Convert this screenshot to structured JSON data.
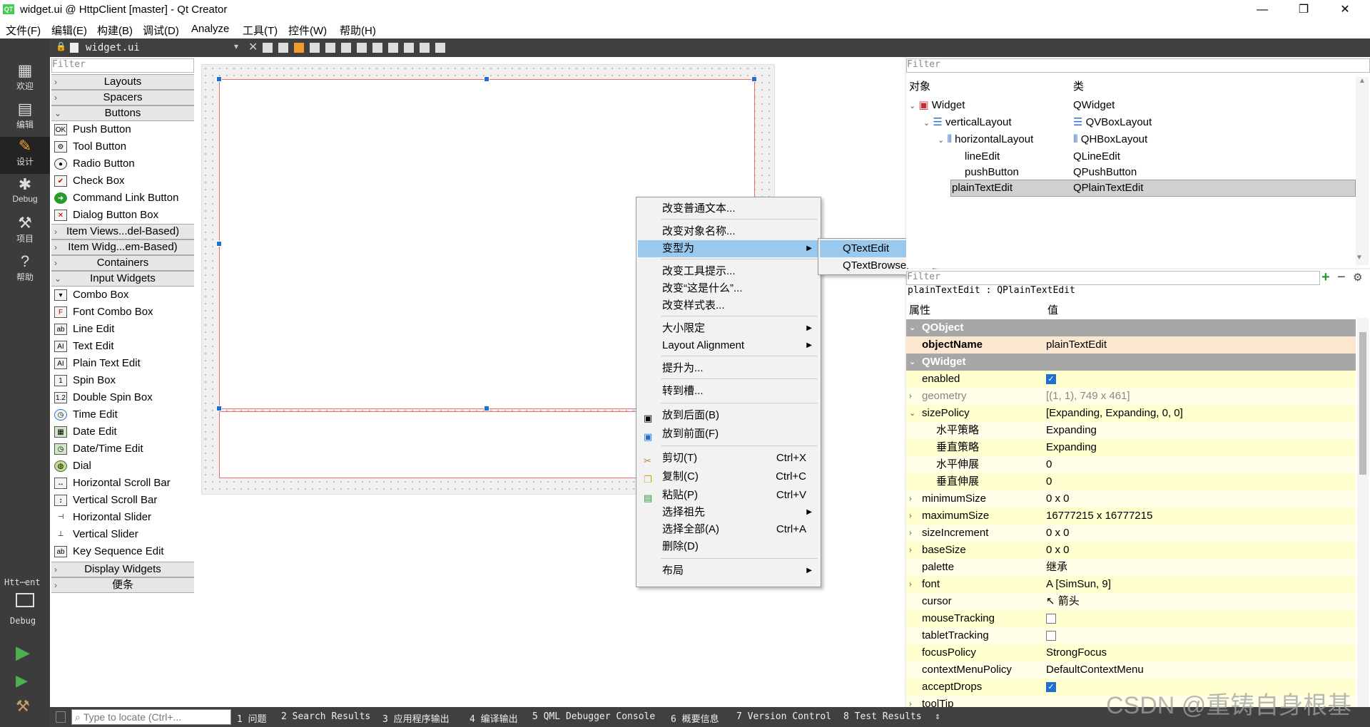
{
  "window": {
    "title": "widget.ui @ HttpClient [master] - Qt Creator",
    "logo": "QT",
    "minimize": "—",
    "maximize": "❐",
    "close": "✕"
  },
  "menubar": [
    "文件(F)",
    "编辑(E)",
    "构建(B)",
    "调试(D)",
    "Analyze",
    "工具(T)",
    "控件(W)",
    "帮助(H)"
  ],
  "modes": [
    {
      "label": "欢迎",
      "icon": "grid-icon"
    },
    {
      "label": "编辑",
      "icon": "document-icon"
    },
    {
      "label": "设计",
      "icon": "pencil-icon"
    },
    {
      "label": "Debug",
      "icon": "bug-icon"
    },
    {
      "label": "项目",
      "icon": "wrench-icon"
    },
    {
      "label": "帮助",
      "icon": "help-icon"
    }
  ],
  "kit": {
    "project": "Htt⋯ent",
    "config": "Debug"
  },
  "editor_tab": {
    "filename": "widget.ui"
  },
  "widgetbox": {
    "filter_placeholder": "Filter",
    "categories": {
      "layouts": "Layouts",
      "spacers": "Spacers",
      "buttons": "Buttons",
      "item_views": "Item Views...del-Based)",
      "item_widgets": "Item Widg...em-Based)",
      "containers": "Containers",
      "input": "Input Widgets",
      "display": "Display Widgets",
      "scratch": "便条"
    },
    "buttons": [
      "Push Button",
      "Tool Button",
      "Radio Button",
      "Check Box",
      "Command Link Button",
      "Dialog Button Box"
    ],
    "input": [
      "Combo Box",
      "Font Combo Box",
      "Line Edit",
      "Text Edit",
      "Plain Text Edit",
      "Spin Box",
      "Double Spin Box",
      "Time Edit",
      "Date Edit",
      "Date/Time Edit",
      "Dial",
      "Horizontal Scroll Bar",
      "Vertical Scroll Bar",
      "Horizontal Slider",
      "Vertical Slider",
      "Key Sequence Edit"
    ]
  },
  "context_menu": {
    "items": [
      "改变普通文本...",
      "改变对象名称...",
      "变型为",
      "改变工具提示...",
      "改变“这是什么”...",
      "改变样式表...",
      "大小限定",
      "Layout Alignment",
      "提升为...",
      "转到槽...",
      "放到后面(B)",
      "放到前面(F)",
      "剪切(T)",
      "复制(C)",
      "粘贴(P)",
      "选择祖先",
      "选择全部(A)",
      "删除(D)",
      "布局"
    ],
    "shortcuts": {
      "cut": "Ctrl+X",
      "copy": "Ctrl+C",
      "paste": "Ctrl+V",
      "select_all": "Ctrl+A"
    },
    "submenu": [
      "QTextEdit",
      "QTextBrowser"
    ]
  },
  "object_inspector": {
    "filter_placeholder": "Filter",
    "headers": [
      "对象",
      "类"
    ],
    "rows": [
      {
        "object": "Widget",
        "class": "QWidget"
      },
      {
        "object": "verticalLayout",
        "class": "QVBoxLayout"
      },
      {
        "object": "horizontalLayout",
        "class": "QHBoxLayout"
      },
      {
        "object": "lineEdit",
        "class": "QLineEdit"
      },
      {
        "object": "pushButton",
        "class": "QPushButton"
      },
      {
        "object": "plainTextEdit",
        "class": "QPlainTextEdit"
      }
    ]
  },
  "property_editor": {
    "filter_placeholder": "Filter",
    "context": "plainTextEdit : QPlainTextEdit",
    "headers": [
      "属性",
      "值"
    ],
    "rows": [
      {
        "name": "QObject",
        "value": ""
      },
      {
        "name": "objectName",
        "value": "plainTextEdit"
      },
      {
        "name": "QWidget",
        "value": ""
      },
      {
        "name": "enabled",
        "value": ""
      },
      {
        "name": "geometry",
        "value": "[(1, 1), 749 x 461]"
      },
      {
        "name": "sizePolicy",
        "value": "[Expanding, Expanding, 0, 0]"
      },
      {
        "name": "水平策略",
        "value": "Expanding"
      },
      {
        "name": "垂直策略",
        "value": "Expanding"
      },
      {
        "name": "水平伸展",
        "value": "0"
      },
      {
        "name": "垂直伸展",
        "value": "0"
      },
      {
        "name": "minimumSize",
        "value": "0 x 0"
      },
      {
        "name": "maximumSize",
        "value": "16777215 x 16777215"
      },
      {
        "name": "sizeIncrement",
        "value": "0 x 0"
      },
      {
        "name": "baseSize",
        "value": "0 x 0"
      },
      {
        "name": "palette",
        "value": "继承"
      },
      {
        "name": "font",
        "value": "[SimSun, 9]"
      },
      {
        "name": "cursor",
        "value": "箭头"
      },
      {
        "name": "mouseTracking",
        "value": ""
      },
      {
        "name": "tabletTracking",
        "value": ""
      },
      {
        "name": "focusPolicy",
        "value": "StrongFocus"
      },
      {
        "name": "contextMenuPolicy",
        "value": "DefaultContextMenu"
      },
      {
        "name": "acceptDrops",
        "value": ""
      },
      {
        "name": "toolTip",
        "value": ""
      }
    ],
    "checks": {
      "enabled": true,
      "mouseTracking": false,
      "tabletTracking": false,
      "acceptDrops": true
    }
  },
  "statusbar": {
    "locate_placeholder": "Type to locate (Ctrl+...",
    "panes": [
      "1 问题",
      "2 Search Results",
      "3 应用程序输出",
      "4 编译输出",
      "5 QML Debugger Console",
      "6 概要信息",
      "7 Version Control",
      "8 Test Results"
    ]
  },
  "watermark": "CSDN @重铸自身根基",
  "colors": {
    "accent": "#1e6fd0",
    "highlight": "#99c9ef",
    "sidebar": "#3c3c3c",
    "selection_border": "#e87070"
  }
}
